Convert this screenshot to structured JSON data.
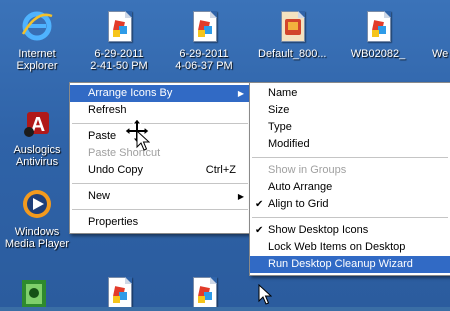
{
  "desktop": {
    "icons": [
      {
        "label": "Internet\nExplorer",
        "icon": "internet-explorer-icon"
      },
      {
        "label": "6-29-2011\n2-41-50 PM",
        "icon": "image-file-icon"
      },
      {
        "label": "6-29-2011\n4-06-37 PM",
        "icon": "image-file-icon"
      },
      {
        "label": "Default_800...",
        "icon": "image-file-icon"
      },
      {
        "label": "WB02082_",
        "icon": "image-file-icon"
      },
      {
        "label": "We",
        "icon": "image-file-icon"
      },
      {
        "label": "Auslogics\nAntivirus",
        "icon": "auslogics-antivirus-icon"
      },
      {
        "label": "Windows\nMedia Player",
        "icon": "windows-media-player-icon"
      }
    ]
  },
  "context_menu": {
    "items": [
      {
        "label": "Arrange Icons By",
        "submenu": true,
        "highlighted": true
      },
      {
        "label": "Refresh"
      },
      {
        "separator": true
      },
      {
        "label": "Paste"
      },
      {
        "label": "Paste Shortcut",
        "disabled": true
      },
      {
        "label": "Undo Copy",
        "shortcut": "Ctrl+Z"
      },
      {
        "separator": true
      },
      {
        "label": "New",
        "submenu": true
      },
      {
        "separator": true
      },
      {
        "label": "Properties"
      }
    ]
  },
  "submenu": {
    "items": [
      {
        "label": "Name"
      },
      {
        "label": "Size"
      },
      {
        "label": "Type"
      },
      {
        "label": "Modified"
      },
      {
        "separator": true
      },
      {
        "label": "Show in Groups",
        "disabled": true
      },
      {
        "label": "Auto Arrange"
      },
      {
        "label": "Align to Grid",
        "checked": true
      },
      {
        "separator": true
      },
      {
        "label": "Show Desktop Icons",
        "checked": true
      },
      {
        "label": "Lock Web Items on Desktop"
      },
      {
        "label": "Run Desktop Cleanup Wizard",
        "highlighted": true
      }
    ]
  }
}
